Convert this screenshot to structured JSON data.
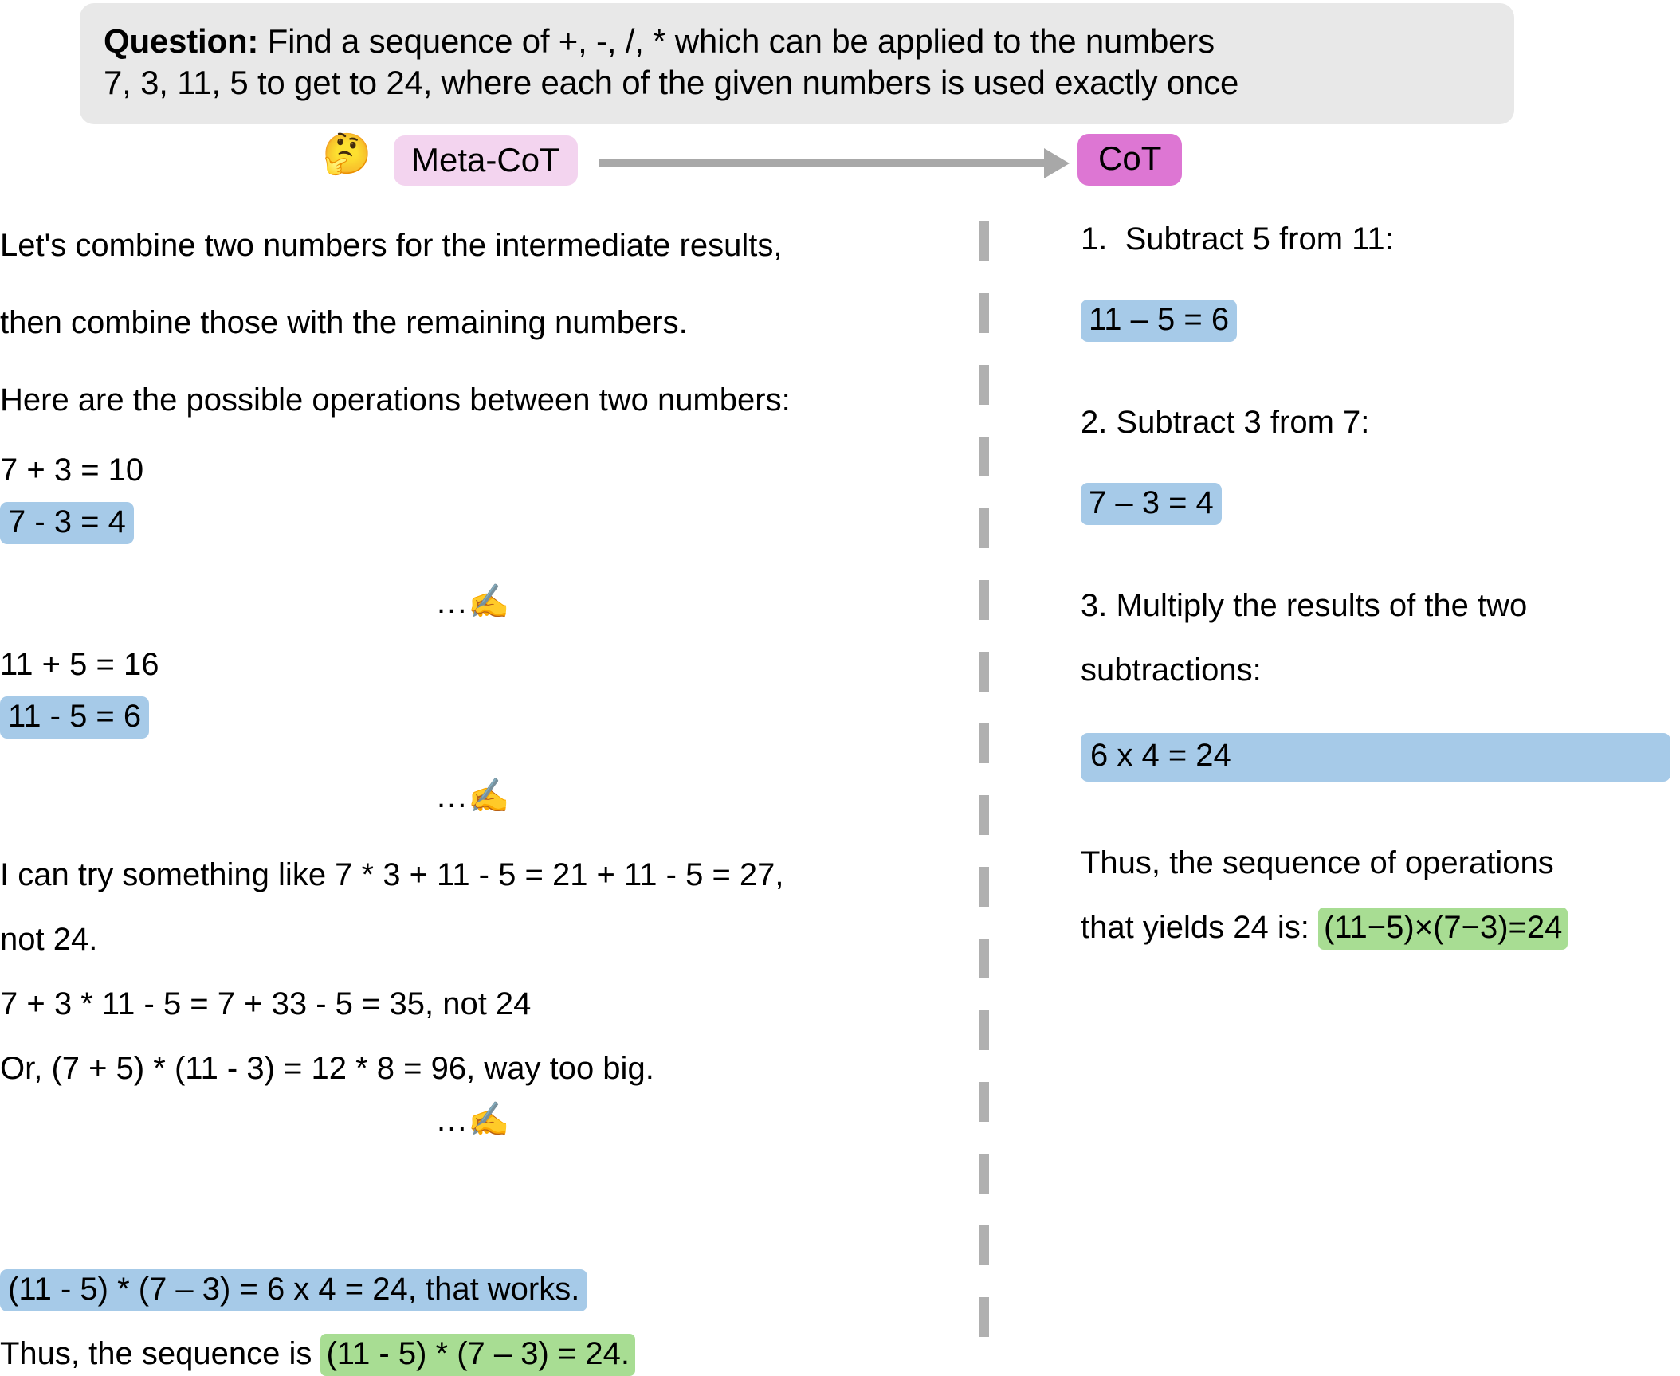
{
  "question": {
    "label": "Question:",
    "line1_rest": " Find a sequence of +, -, /, * which can be applied to the numbers",
    "line2": "7, 3, 11, 5 to get to 24, where each of the given numbers is used exactly once"
  },
  "header": {
    "thinking_icon": "🤔",
    "metacot_label": "Meta-CoT",
    "cot_label": "CoT",
    "arrow_icon": "arrow-right",
    "metacot_bg": "#f3d4ef",
    "cot_bg": "#dd76d3",
    "arrow_color": "#a8a8a8"
  },
  "colors": {
    "highlight_blue": "#a6cae8",
    "highlight_green": "#a8dd93",
    "banner_bg": "#e8e8e8",
    "divider": "#b0b0b0"
  },
  "meta_cot": {
    "intro_line1": "Let's combine two numbers for the intermediate results,",
    "intro_line2": "then combine those with the remaining numbers.",
    "intro_line3": "Here are the possible operations between two numbers:",
    "eq_1": "7 + 3 = 10",
    "eq_2_highlight": "7 - 3 = 4",
    "separator_1": "...",
    "separator_icon": "✍",
    "eq_3": "11 + 5 = 16",
    "eq_4_highlight": "11 - 5 = 6",
    "separator_2": "...",
    "try_line1": "I can try something like 7 * 3 + 11 - 5 = 21 + 11 - 5 = 27,",
    "try_line2": "not 24.",
    "try_line3": "7 + 3 * 11 - 5 = 7 + 33 - 5 = 35, not 24",
    "try_line4": "Or, (7 + 5) * (11 - 3) = 12 * 8 = 96, way too big.",
    "separator_3": "...",
    "result_highlight": "(11 - 5) * (7 – 3) = 6 x 4 = 24, that works.",
    "conclusion_prefix": "Thus, the sequence is ",
    "conclusion_highlight": "(11 - 5) * (7 – 3) = 24."
  },
  "cot": {
    "step1_label": "1.  Subtract 5 from 11:",
    "step1_eq": "11 – 5 = 6",
    "step2_label": "2. Subtract 3 from 7:",
    "step2_eq": "7 – 3 = 4",
    "step3_label_line1": "3. Multiply the results of the two",
    "step3_label_line2": "subtractions:",
    "step3_eq": "6 x 4 = 24",
    "conclusion_line1": "Thus, the sequence of operations",
    "conclusion_prefix": "that yields 24 is: ",
    "conclusion_highlight": "(11−5)×(7−3)=24"
  }
}
